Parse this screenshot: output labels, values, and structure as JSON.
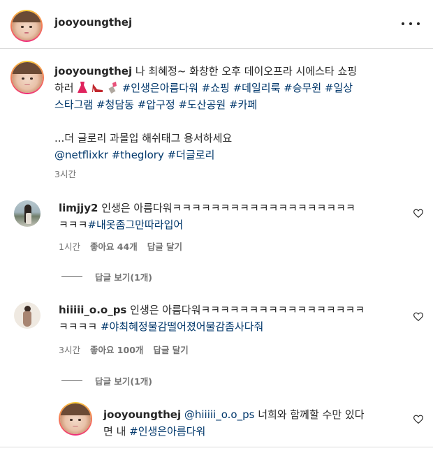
{
  "header": {
    "username": "jooyoungthej",
    "more_icon": "more-horizontal-icon"
  },
  "caption": {
    "username": "jooyoungthej",
    "text_line1": " 나 최혜정~ 화창한 오후 데이오프라 시에스타 쇼핑",
    "text_line2_prefix": "하러",
    "emojis": [
      "dress-emoji",
      "heels-emoji",
      "lipstick-emoji"
    ],
    "hashtags_line2": "#인생은아름다워 #쇼핑 #데일리룩 #승무원 #일상",
    "hashtags_line3": "스타그램 #청담동 #압구정 #도산공원 #카페",
    "text_line4": "...더 글로리 과몰입 해쉬태그 용서하세요",
    "tags_line5": "@netflixkr #theglory #더글로리",
    "time": "3시간"
  },
  "comments": [
    {
      "username": "limjjy2",
      "text_line1": " 인생은 아름다워ㅋㅋㅋㅋㅋㅋㅋㅋㅋㅋㅋㅋㅋㅋㅋㅋㅋㅋㅋ",
      "text_line2_plain": "ㅋㅋㅋ",
      "text_line2_tag": "#내옷좀그만따라입어",
      "time": "1시간",
      "likes": "좋아요 44개",
      "reply_label": "답글 달기",
      "view_replies": "답글 보기(1개)"
    },
    {
      "username": "hiiiii_o.o_ps",
      "text_line1": " 인생은 아름다워ㅋㅋㅋㅋㅋㅋㅋㅋㅋㅋㅋㅋㅋㅋㅋㅋㅋ",
      "text_line2_plain": "ㅋㅋㅋㅋ ",
      "text_line2_tag": "#야최혜정물감떨어졌어물감좀사다줘",
      "time": "3시간",
      "likes": "좋아요 100개",
      "reply_label": "답글 달기",
      "view_replies": "답글 보기(1개)"
    }
  ],
  "reply": {
    "username": "jooyoungthej",
    "mention": "@hiiiii_o.o_ps",
    "text_line1": " 너희와 함께할 수만 있다",
    "text_line2_plain": "면 내 ",
    "text_line2_tag": "#인생은아름다워"
  },
  "colors": {
    "hashtag": "#00376b",
    "text": "#262626",
    "meta": "#737373",
    "divider": "#dbdbdb"
  }
}
